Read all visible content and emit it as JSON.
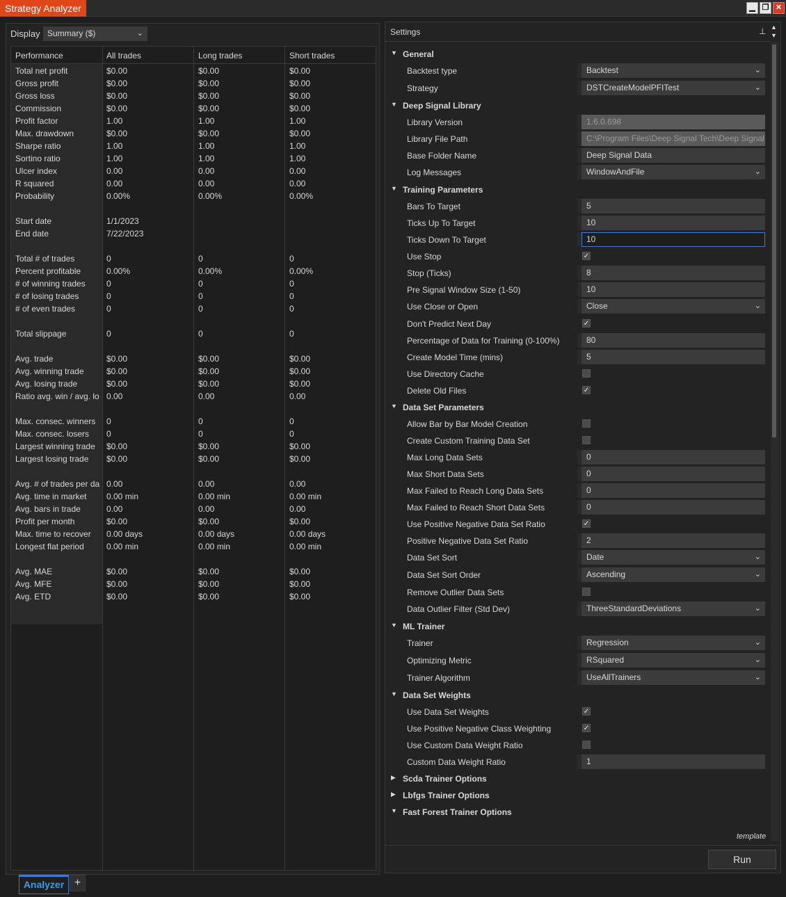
{
  "window": {
    "title": "Strategy Analyzer",
    "buttons": [
      "▁",
      "❐",
      "✕"
    ]
  },
  "display": {
    "label": "Display",
    "selected": "Summary ($)"
  },
  "performance": {
    "headers": [
      "Performance",
      "All trades",
      "Long trades",
      "Short trades"
    ],
    "rows": [
      [
        "Total net profit",
        "$0.00",
        "$0.00",
        "$0.00"
      ],
      [
        "Gross profit",
        "$0.00",
        "$0.00",
        "$0.00"
      ],
      [
        "Gross loss",
        "$0.00",
        "$0.00",
        "$0.00"
      ],
      [
        "Commission",
        "$0.00",
        "$0.00",
        "$0.00"
      ],
      [
        "Profit factor",
        "1.00",
        "1.00",
        "1.00"
      ],
      [
        "Max. drawdown",
        "$0.00",
        "$0.00",
        "$0.00"
      ],
      [
        "Sharpe ratio",
        "1.00",
        "1.00",
        "1.00"
      ],
      [
        "Sortino ratio",
        "1.00",
        "1.00",
        "1.00"
      ],
      [
        "Ulcer index",
        "0.00",
        "0.00",
        "0.00"
      ],
      [
        "R squared",
        "0.00",
        "0.00",
        "0.00"
      ],
      [
        "Probability",
        "0.00%",
        "0.00%",
        "0.00%"
      ],
      [
        "",
        "",
        "",
        ""
      ],
      [
        "Start date",
        "1/1/2023",
        "",
        ""
      ],
      [
        "End date",
        "7/22/2023",
        "",
        ""
      ],
      [
        "",
        "",
        "",
        ""
      ],
      [
        "Total # of trades",
        "0",
        "0",
        "0"
      ],
      [
        "Percent profitable",
        "0.00%",
        "0.00%",
        "0.00%"
      ],
      [
        "# of winning trades",
        "0",
        "0",
        "0"
      ],
      [
        "# of losing trades",
        "0",
        "0",
        "0"
      ],
      [
        "# of even trades",
        "0",
        "0",
        "0"
      ],
      [
        "",
        "",
        "",
        ""
      ],
      [
        "Total slippage",
        "0",
        "0",
        "0"
      ],
      [
        "",
        "",
        "",
        ""
      ],
      [
        "Avg. trade",
        "$0.00",
        "$0.00",
        "$0.00"
      ],
      [
        "Avg. winning trade",
        "$0.00",
        "$0.00",
        "$0.00"
      ],
      [
        "Avg. losing trade",
        "$0.00",
        "$0.00",
        "$0.00"
      ],
      [
        "Ratio avg. win / avg. lo",
        "0.00",
        "0.00",
        "0.00"
      ],
      [
        "",
        "",
        "",
        ""
      ],
      [
        "Max. consec. winners",
        "0",
        "0",
        "0"
      ],
      [
        "Max. consec. losers",
        "0",
        "0",
        "0"
      ],
      [
        "Largest winning trade",
        "$0.00",
        "$0.00",
        "$0.00"
      ],
      [
        "Largest losing trade",
        "$0.00",
        "$0.00",
        "$0.00"
      ],
      [
        "",
        "",
        "",
        ""
      ],
      [
        "Avg. # of trades per da",
        "0.00",
        "0.00",
        "0.00"
      ],
      [
        "Avg. time in market",
        "0.00 min",
        "0.00 min",
        "0.00 min"
      ],
      [
        "Avg. bars in trade",
        "0.00",
        "0.00",
        "0.00"
      ],
      [
        "Profit per month",
        "$0.00",
        "$0.00",
        "$0.00"
      ],
      [
        "Max. time to recover",
        "0.00 days",
        "0.00 days",
        "0.00 days"
      ],
      [
        "Longest flat period",
        "0.00 min",
        "0.00 min",
        "0.00 min"
      ],
      [
        "",
        "",
        "",
        ""
      ],
      [
        "Avg. MAE",
        "$0.00",
        "$0.00",
        "$0.00"
      ],
      [
        "Avg. MFE",
        "$0.00",
        "$0.00",
        "$0.00"
      ],
      [
        "Avg. ETD",
        "$0.00",
        "$0.00",
        "$0.00"
      ]
    ]
  },
  "settings": {
    "title": "Settings",
    "template_label": "template",
    "run_label": "Run",
    "items": [
      {
        "kind": "cat",
        "label": "General",
        "expanded": true
      },
      {
        "kind": "select",
        "label": "Backtest type",
        "value": "Backtest"
      },
      {
        "kind": "select",
        "label": "Strategy",
        "value": "DSTCreateModelPFITest"
      },
      {
        "kind": "cat",
        "label": "Deep Signal Library",
        "expanded": true
      },
      {
        "kind": "disabled",
        "label": "Library Version",
        "value": "1.6.0.698"
      },
      {
        "kind": "disabled",
        "label": "Library File Path",
        "value": "C:\\Program Files\\Deep Signal Tech\\Deep Signal"
      },
      {
        "kind": "text",
        "label": "Base Folder Name",
        "value": "Deep Signal Data"
      },
      {
        "kind": "select",
        "label": "Log Messages",
        "value": "WindowAndFile"
      },
      {
        "kind": "cat",
        "label": "Training Parameters",
        "expanded": true
      },
      {
        "kind": "text",
        "label": "Bars To Target",
        "value": "5"
      },
      {
        "kind": "text",
        "label": "Ticks Up To Target",
        "value": "10"
      },
      {
        "kind": "focused",
        "label": "Ticks Down To Target",
        "value": "10"
      },
      {
        "kind": "check",
        "label": "Use Stop",
        "checked": true
      },
      {
        "kind": "text",
        "label": "Stop (Ticks)",
        "value": "8"
      },
      {
        "kind": "text",
        "label": "Pre Signal Window Size (1-50)",
        "value": "10"
      },
      {
        "kind": "select",
        "label": "Use Close or Open",
        "value": "Close"
      },
      {
        "kind": "check",
        "label": "Don't Predict Next Day",
        "checked": true
      },
      {
        "kind": "text",
        "label": "Percentage of Data for Training (0-100%)",
        "value": "80"
      },
      {
        "kind": "text",
        "label": "Create Model Time (mins)",
        "value": "5"
      },
      {
        "kind": "check",
        "label": "Use Directory Cache",
        "checked": false
      },
      {
        "kind": "check",
        "label": "Delete Old Files",
        "checked": true
      },
      {
        "kind": "cat",
        "label": "Data Set Parameters",
        "expanded": true
      },
      {
        "kind": "check",
        "label": "Allow Bar by Bar Model Creation",
        "checked": false
      },
      {
        "kind": "check",
        "label": "Create Custom Training Data Set",
        "checked": false
      },
      {
        "kind": "text",
        "label": "Max Long Data Sets",
        "value": "0"
      },
      {
        "kind": "text",
        "label": "Max Short Data Sets",
        "value": "0"
      },
      {
        "kind": "text",
        "label": "Max Failed to Reach Long Data Sets",
        "value": "0"
      },
      {
        "kind": "text",
        "label": "Max Failed to Reach Short Data Sets",
        "value": "0"
      },
      {
        "kind": "check",
        "label": "Use Positive Negative Data Set Ratio",
        "checked": true
      },
      {
        "kind": "text",
        "label": "Positive Negative Data Set Ratio",
        "value": "2"
      },
      {
        "kind": "select",
        "label": "Data Set Sort",
        "value": "Date"
      },
      {
        "kind": "select",
        "label": "Data Set Sort Order",
        "value": "Ascending"
      },
      {
        "kind": "check",
        "label": "Remove Outlier Data Sets",
        "checked": false
      },
      {
        "kind": "select",
        "label": "Data Outlier Filter (Std Dev)",
        "value": "ThreeStandardDeviations"
      },
      {
        "kind": "cat",
        "label": "ML Trainer",
        "expanded": true
      },
      {
        "kind": "select",
        "label": "Trainer",
        "value": "Regression"
      },
      {
        "kind": "select",
        "label": "Optimizing Metric",
        "value": "RSquared"
      },
      {
        "kind": "select",
        "label": "Trainer Algorithm",
        "value": "UseAllTrainers"
      },
      {
        "kind": "cat",
        "label": "Data Set Weights",
        "expanded": true
      },
      {
        "kind": "check",
        "label": "Use Data Set Weights",
        "checked": true
      },
      {
        "kind": "check",
        "label": "Use Positive Negative Class Weighting",
        "checked": true
      },
      {
        "kind": "check",
        "label": "Use Custom Data Weight Ratio",
        "checked": false
      },
      {
        "kind": "text",
        "label": "Custom Data Weight Ratio",
        "value": "1"
      },
      {
        "kind": "cat",
        "label": "Scda Trainer Options",
        "expanded": false
      },
      {
        "kind": "cat",
        "label": "Lbfgs Trainer Options",
        "expanded": false
      },
      {
        "kind": "cat",
        "label": "Fast Forest Trainer Options",
        "expanded": true
      }
    ]
  },
  "bottom_tabs": {
    "active": "Analyzer",
    "add": "+"
  }
}
